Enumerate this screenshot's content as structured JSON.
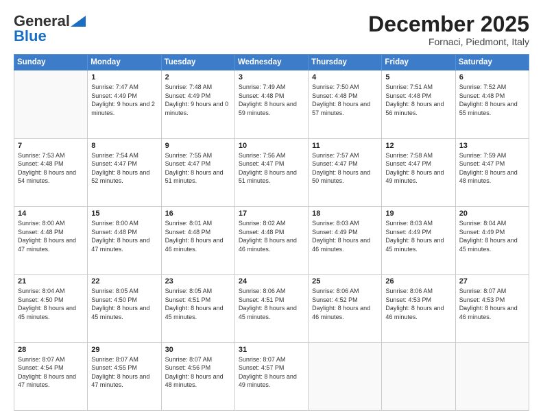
{
  "header": {
    "logo_general": "General",
    "logo_blue": "Blue",
    "month": "December 2025",
    "location": "Fornaci, Piedmont, Italy"
  },
  "weekdays": [
    "Sunday",
    "Monday",
    "Tuesday",
    "Wednesday",
    "Thursday",
    "Friday",
    "Saturday"
  ],
  "weeks": [
    [
      {
        "day": "",
        "empty": true
      },
      {
        "day": "1",
        "sunrise": "7:47 AM",
        "sunset": "4:49 PM",
        "daylight": "9 hours and 2 minutes."
      },
      {
        "day": "2",
        "sunrise": "7:48 AM",
        "sunset": "4:49 PM",
        "daylight": "9 hours and 0 minutes."
      },
      {
        "day": "3",
        "sunrise": "7:49 AM",
        "sunset": "4:48 PM",
        "daylight": "8 hours and 59 minutes."
      },
      {
        "day": "4",
        "sunrise": "7:50 AM",
        "sunset": "4:48 PM",
        "daylight": "8 hours and 57 minutes."
      },
      {
        "day": "5",
        "sunrise": "7:51 AM",
        "sunset": "4:48 PM",
        "daylight": "8 hours and 56 minutes."
      },
      {
        "day": "6",
        "sunrise": "7:52 AM",
        "sunset": "4:48 PM",
        "daylight": "8 hours and 55 minutes."
      }
    ],
    [
      {
        "day": "7",
        "sunrise": "7:53 AM",
        "sunset": "4:48 PM",
        "daylight": "8 hours and 54 minutes."
      },
      {
        "day": "8",
        "sunrise": "7:54 AM",
        "sunset": "4:47 PM",
        "daylight": "8 hours and 52 minutes."
      },
      {
        "day": "9",
        "sunrise": "7:55 AM",
        "sunset": "4:47 PM",
        "daylight": "8 hours and 51 minutes."
      },
      {
        "day": "10",
        "sunrise": "7:56 AM",
        "sunset": "4:47 PM",
        "daylight": "8 hours and 51 minutes."
      },
      {
        "day": "11",
        "sunrise": "7:57 AM",
        "sunset": "4:47 PM",
        "daylight": "8 hours and 50 minutes."
      },
      {
        "day": "12",
        "sunrise": "7:58 AM",
        "sunset": "4:47 PM",
        "daylight": "8 hours and 49 minutes."
      },
      {
        "day": "13",
        "sunrise": "7:59 AM",
        "sunset": "4:47 PM",
        "daylight": "8 hours and 48 minutes."
      }
    ],
    [
      {
        "day": "14",
        "sunrise": "8:00 AM",
        "sunset": "4:48 PM",
        "daylight": "8 hours and 47 minutes."
      },
      {
        "day": "15",
        "sunrise": "8:00 AM",
        "sunset": "4:48 PM",
        "daylight": "8 hours and 47 minutes."
      },
      {
        "day": "16",
        "sunrise": "8:01 AM",
        "sunset": "4:48 PM",
        "daylight": "8 hours and 46 minutes."
      },
      {
        "day": "17",
        "sunrise": "8:02 AM",
        "sunset": "4:48 PM",
        "daylight": "8 hours and 46 minutes."
      },
      {
        "day": "18",
        "sunrise": "8:03 AM",
        "sunset": "4:49 PM",
        "daylight": "8 hours and 46 minutes."
      },
      {
        "day": "19",
        "sunrise": "8:03 AM",
        "sunset": "4:49 PM",
        "daylight": "8 hours and 45 minutes."
      },
      {
        "day": "20",
        "sunrise": "8:04 AM",
        "sunset": "4:49 PM",
        "daylight": "8 hours and 45 minutes."
      }
    ],
    [
      {
        "day": "21",
        "sunrise": "8:04 AM",
        "sunset": "4:50 PM",
        "daylight": "8 hours and 45 minutes."
      },
      {
        "day": "22",
        "sunrise": "8:05 AM",
        "sunset": "4:50 PM",
        "daylight": "8 hours and 45 minutes."
      },
      {
        "day": "23",
        "sunrise": "8:05 AM",
        "sunset": "4:51 PM",
        "daylight": "8 hours and 45 minutes."
      },
      {
        "day": "24",
        "sunrise": "8:06 AM",
        "sunset": "4:51 PM",
        "daylight": "8 hours and 45 minutes."
      },
      {
        "day": "25",
        "sunrise": "8:06 AM",
        "sunset": "4:52 PM",
        "daylight": "8 hours and 46 minutes."
      },
      {
        "day": "26",
        "sunrise": "8:06 AM",
        "sunset": "4:53 PM",
        "daylight": "8 hours and 46 minutes."
      },
      {
        "day": "27",
        "sunrise": "8:07 AM",
        "sunset": "4:53 PM",
        "daylight": "8 hours and 46 minutes."
      }
    ],
    [
      {
        "day": "28",
        "sunrise": "8:07 AM",
        "sunset": "4:54 PM",
        "daylight": "8 hours and 47 minutes."
      },
      {
        "day": "29",
        "sunrise": "8:07 AM",
        "sunset": "4:55 PM",
        "daylight": "8 hours and 47 minutes."
      },
      {
        "day": "30",
        "sunrise": "8:07 AM",
        "sunset": "4:56 PM",
        "daylight": "8 hours and 48 minutes."
      },
      {
        "day": "31",
        "sunrise": "8:07 AM",
        "sunset": "4:57 PM",
        "daylight": "8 hours and 49 minutes."
      },
      {
        "day": "",
        "empty": true
      },
      {
        "day": "",
        "empty": true
      },
      {
        "day": "",
        "empty": true
      }
    ]
  ]
}
